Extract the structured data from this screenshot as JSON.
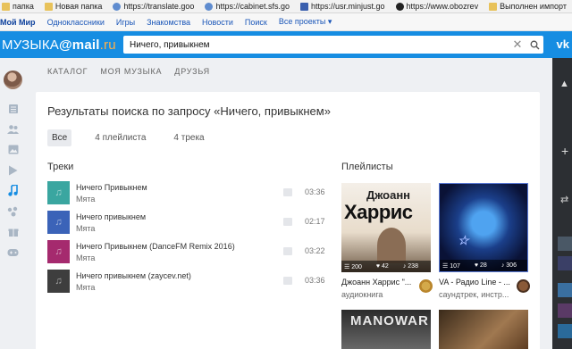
{
  "bookmarks": [
    {
      "label": "папка",
      "icon": "folder-icon"
    },
    {
      "label": "Новая папка",
      "icon": "folder-icon"
    },
    {
      "label": "https://translate.goo",
      "icon": "globe-icon"
    },
    {
      "label": "https://cabinet.sfs.go",
      "icon": "globe-icon"
    },
    {
      "label": "https://usr.minjust.go",
      "icon": "emblem-icon"
    },
    {
      "label": "https://www.obozrev",
      "icon": "github-icon"
    },
    {
      "label": "Выполнен импорт",
      "icon": "folder-icon"
    }
  ],
  "portal": {
    "links": [
      "Мой Мир",
      "Одноклассники",
      "Игры",
      "Знакомства",
      "Новости",
      "Поиск",
      "Все проекты ▾"
    ]
  },
  "header": {
    "logo_prefix": "МУЗЫКА",
    "logo_at": "@mail",
    "logo_suffix": ".ru",
    "search_value": "Ничего, привыкнем",
    "vk": "vk"
  },
  "tabs": [
    "КАТАЛОГ",
    "МОЯ МУЗЫКА",
    "ДРУЗЬЯ"
  ],
  "page": {
    "title": "Результаты поиска по запросу «Ничего, привыкнем»",
    "filters": [
      "Все",
      "4 плейлиста",
      "4 трека"
    ],
    "active_filter": "Все"
  },
  "tracks_section": {
    "title": "Треки",
    "items": [
      {
        "title": "Ничего Привыкнем",
        "artist": "Мята",
        "duration": "03:36",
        "cover_color": "#3aa6a0"
      },
      {
        "title": "Ничего привыкнем",
        "artist": "Мята",
        "duration": "02:17",
        "cover_color": "#3b63b8"
      },
      {
        "title": "Ничего Привыкнем (DanceFM Remix 2016)",
        "artist": "Мята",
        "duration": "03:22",
        "cover_color": "#a52a6e"
      },
      {
        "title": "Ничего привыкнем (zaycev.net)",
        "artist": "Мята",
        "duration": "03:36",
        "cover_color": "#3e3e3e"
      }
    ]
  },
  "playlists_section": {
    "title": "Плейлисты",
    "items": [
      {
        "cover_text_1": "Джоанн",
        "cover_text_2": "Харрис",
        "tracks": "200",
        "likes": "42",
        "listens": "238",
        "title": "Джоанн Харрис \"...",
        "subtitle": "аудиокнига"
      },
      {
        "cover_text_1": "",
        "cover_text_2": "",
        "tracks": "107",
        "likes": "28",
        "listens": "306",
        "title": "VA - Радио Line - ...",
        "subtitle": "саундтрек, инстр..."
      },
      {
        "cover_text_1": "MANOWAR",
        "cover_text_2": "",
        "tracks": "",
        "likes": "",
        "listens": "",
        "title": "",
        "subtitle": ""
      },
      {
        "cover_text_1": "",
        "cover_text_2": "",
        "tracks": "",
        "likes": "",
        "listens": "",
        "title": "",
        "subtitle": ""
      }
    ]
  },
  "colors": {
    "header_blue": "#168de2",
    "logo_accent": "#ffb04a",
    "link_blue": "#1a56b8"
  }
}
